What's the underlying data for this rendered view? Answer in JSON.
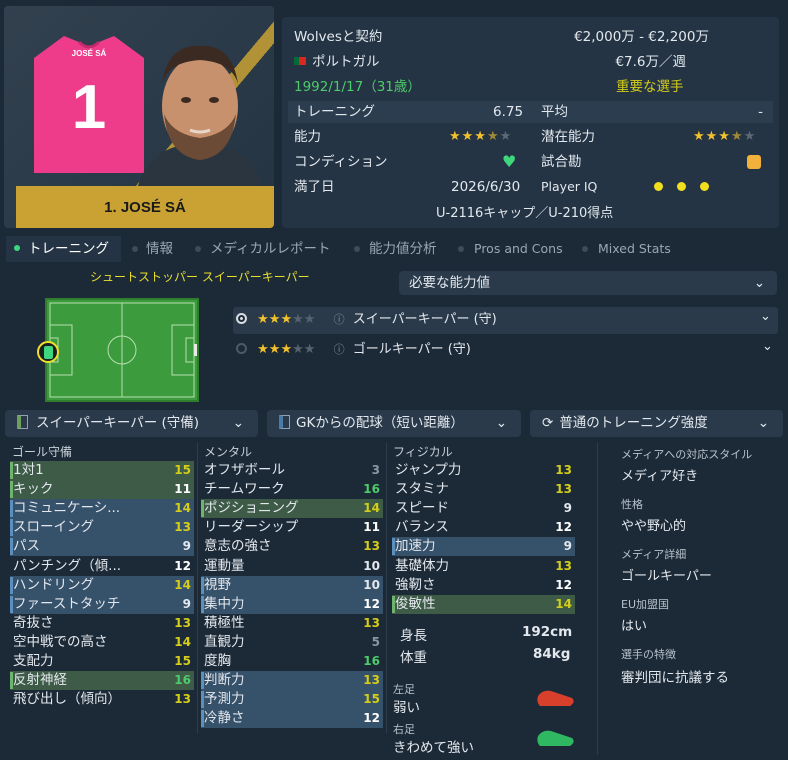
{
  "player": {
    "name": "1. JOSÉ SÁ",
    "shirt_number": "1",
    "shirt_name": "JOSÉ SÁ",
    "shirt_color": "#ef3c8a"
  },
  "info": {
    "contract": "Wolvesと契約",
    "value": "€2,000万 - €2,200万",
    "nationality": "ポルトガル",
    "wage": "€7.6万／週",
    "birth": "1992/1/17（31歳）",
    "status": "重要な選手",
    "training_label": "トレーニング",
    "training_value": "6.75",
    "average_label": "平均",
    "average_value": "-",
    "ability_label": "能力",
    "ability_stars": 3.5,
    "potential_label": "潜在能力",
    "potential_stars": 3.5,
    "condition_label": "コンディション",
    "match_fitness_label": "試合勘",
    "expiry_label": "満了日",
    "expiry_value": "2026/6/30",
    "iq_label": "Player IQ",
    "iq_dots": 3,
    "youth": "U-2116キャップ／U-210得点"
  },
  "tabs": [
    "トレーニング",
    "情報",
    "メディカルレポート",
    "能力値分析",
    "Pros and Cons",
    "Mixed Stats"
  ],
  "roles": {
    "title": "シュートストッパー スイーパーキーパー",
    "dropdown": "必要な能力値",
    "items": [
      {
        "stars": 3,
        "label": "スイーパーキーパー (守)"
      },
      {
        "stars": 3,
        "label": "ゴールキーパー (守)"
      }
    ]
  },
  "filters": {
    "role": "スイーパーキーパー (守備)",
    "duty": "GKからの配球（短い距離）",
    "intensity": "普通のトレーニング強度"
  },
  "goalkeeping": {
    "header": "ゴール守備",
    "items": [
      {
        "name": "1対1",
        "value": "15"
      },
      {
        "name": "キック",
        "value": "11"
      },
      {
        "name": "コミュニケーシ...",
        "value": "14"
      },
      {
        "name": "スローイング",
        "value": "13"
      },
      {
        "name": "パス",
        "value": "9"
      },
      {
        "name": "パンチング（傾...",
        "value": "12"
      },
      {
        "name": "ハンドリング",
        "value": "14"
      },
      {
        "name": "ファーストタッチ",
        "value": "9"
      },
      {
        "name": "奇抜さ",
        "value": "13"
      },
      {
        "name": "空中戦での高さ",
        "value": "14"
      },
      {
        "name": "支配力",
        "value": "15"
      },
      {
        "name": "反射神経",
        "value": "16"
      },
      {
        "name": "飛び出し（傾向）",
        "value": "13"
      }
    ]
  },
  "mental": {
    "header": "メンタル",
    "items": [
      {
        "name": "オフザボール",
        "value": "3"
      },
      {
        "name": "チームワーク",
        "value": "16"
      },
      {
        "name": "ポジショニング",
        "value": "14"
      },
      {
        "name": "リーダーシップ",
        "value": "11"
      },
      {
        "name": "意志の強さ",
        "value": "13"
      },
      {
        "name": "運動量",
        "value": "10"
      },
      {
        "name": "視野",
        "value": "10"
      },
      {
        "name": "集中力",
        "value": "12"
      },
      {
        "name": "積極性",
        "value": "13"
      },
      {
        "name": "直観力",
        "value": "5"
      },
      {
        "name": "度胸",
        "value": "16"
      },
      {
        "name": "判断力",
        "value": "13"
      },
      {
        "name": "予測力",
        "value": "15"
      },
      {
        "name": "冷静さ",
        "value": "12"
      }
    ]
  },
  "physical": {
    "header": "フィジカル",
    "items": [
      {
        "name": "ジャンプ力",
        "value": "13"
      },
      {
        "name": "スタミナ",
        "value": "13"
      },
      {
        "name": "スピード",
        "value": "9"
      },
      {
        "name": "バランス",
        "value": "12"
      },
      {
        "name": "加速力",
        "value": "9"
      },
      {
        "name": "基礎体力",
        "value": "13"
      },
      {
        "name": "強靭さ",
        "value": "12"
      },
      {
        "name": "俊敏性",
        "value": "14"
      }
    ],
    "height_label": "身長",
    "height": "192cm",
    "weight_label": "体重",
    "weight": "84kg",
    "left_foot_label": "左足",
    "left_foot": "弱い",
    "right_foot_label": "右足",
    "right_foot": "きわめて強い"
  },
  "side": {
    "media_style_label": "メディアへの対応スタイル",
    "media_style": "メディア好き",
    "personality_label": "性格",
    "personality": "やや野心的",
    "media_detail_label": "メディア詳細",
    "media_detail": "ゴールキーパー",
    "eu_label": "EU加盟国",
    "eu": "はい",
    "traits_label": "選手の特徴",
    "traits": "審判団に抗議する"
  },
  "colors": {
    "highlight_yellow": "#d4cd19",
    "highlight_green": "#4ecb6b",
    "gold": "#c9a233"
  }
}
